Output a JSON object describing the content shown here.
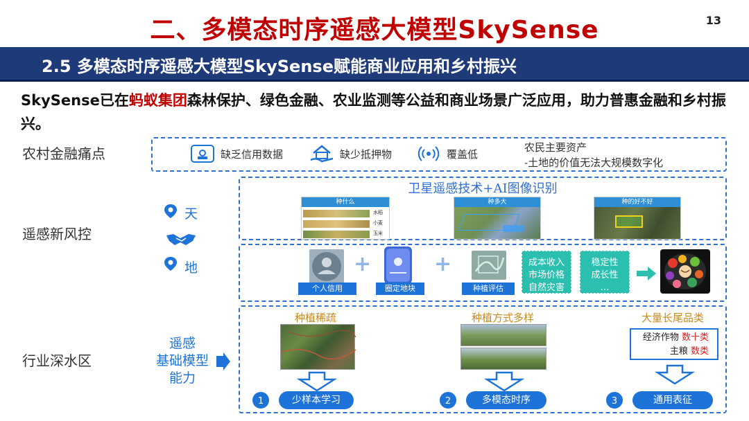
{
  "header": {
    "title": "二、多模态时序遥感大模型SkySense",
    "page_number": "13",
    "subtitle": "2.5 多模态时序遥感大模型SkySense赋能商业应用和乡村振兴"
  },
  "intro": {
    "part1": "SkySense已在",
    "highlight": "蚂蚁集团",
    "part2": "森林保护、绿色金融、农业监测等公益和商业场景广泛应用，助力普惠金融和乡村振兴。"
  },
  "rows": {
    "finance_label": "农村金融痛点",
    "risk_label": "遥感新风控",
    "industry_label": "行业深水区"
  },
  "finance": {
    "items": [
      {
        "icon": "credit-card-icon",
        "label": "缺乏信用数据"
      },
      {
        "icon": "house-hand-icon",
        "label": "缺少抵押物"
      },
      {
        "icon": "signal-icon",
        "label": "覆盖低"
      }
    ],
    "assets_line1": "农民主要资产",
    "assets_line2": "-土地的价值无法大规模数字化"
  },
  "risk": {
    "sky_label": "天",
    "ground_label": "地",
    "satellite_title": "卫星遥感技术+AI图像识别",
    "sat_captions": [
      "种什么",
      "种多大",
      "种的好不好"
    ],
    "crop_names": [
      "水稻",
      "小麦",
      "玉米"
    ],
    "chain_tags": [
      "个人信用",
      "圈定地块",
      "种植评估"
    ],
    "factors1": [
      "成本收入",
      "市场价格",
      "自然灾害"
    ],
    "factors2": [
      "稳定性",
      "成长性",
      "…"
    ]
  },
  "industry": {
    "left_line1": "遥感",
    "left_line2": "基础模型",
    "left_line3": "能力",
    "col_titles": [
      "种植稀疏",
      "种植方式多样",
      "大量长尾品类"
    ],
    "crops_line1_label": "经济作物",
    "crops_line1_value": "数十类",
    "crops_line2_label": "主粮",
    "crops_line2_value": "数类",
    "steps": [
      {
        "num": "1",
        "label": "少样本学习"
      },
      {
        "num": "2",
        "label": "多模态时序"
      },
      {
        "num": "3",
        "label": "通用表征"
      }
    ]
  },
  "colors": {
    "title_red": "#c00000",
    "banner_navy": "#1f3a78",
    "accent_blue": "#1e73d8",
    "teal": "#2bbfb0",
    "gold": "#c98a1a"
  }
}
